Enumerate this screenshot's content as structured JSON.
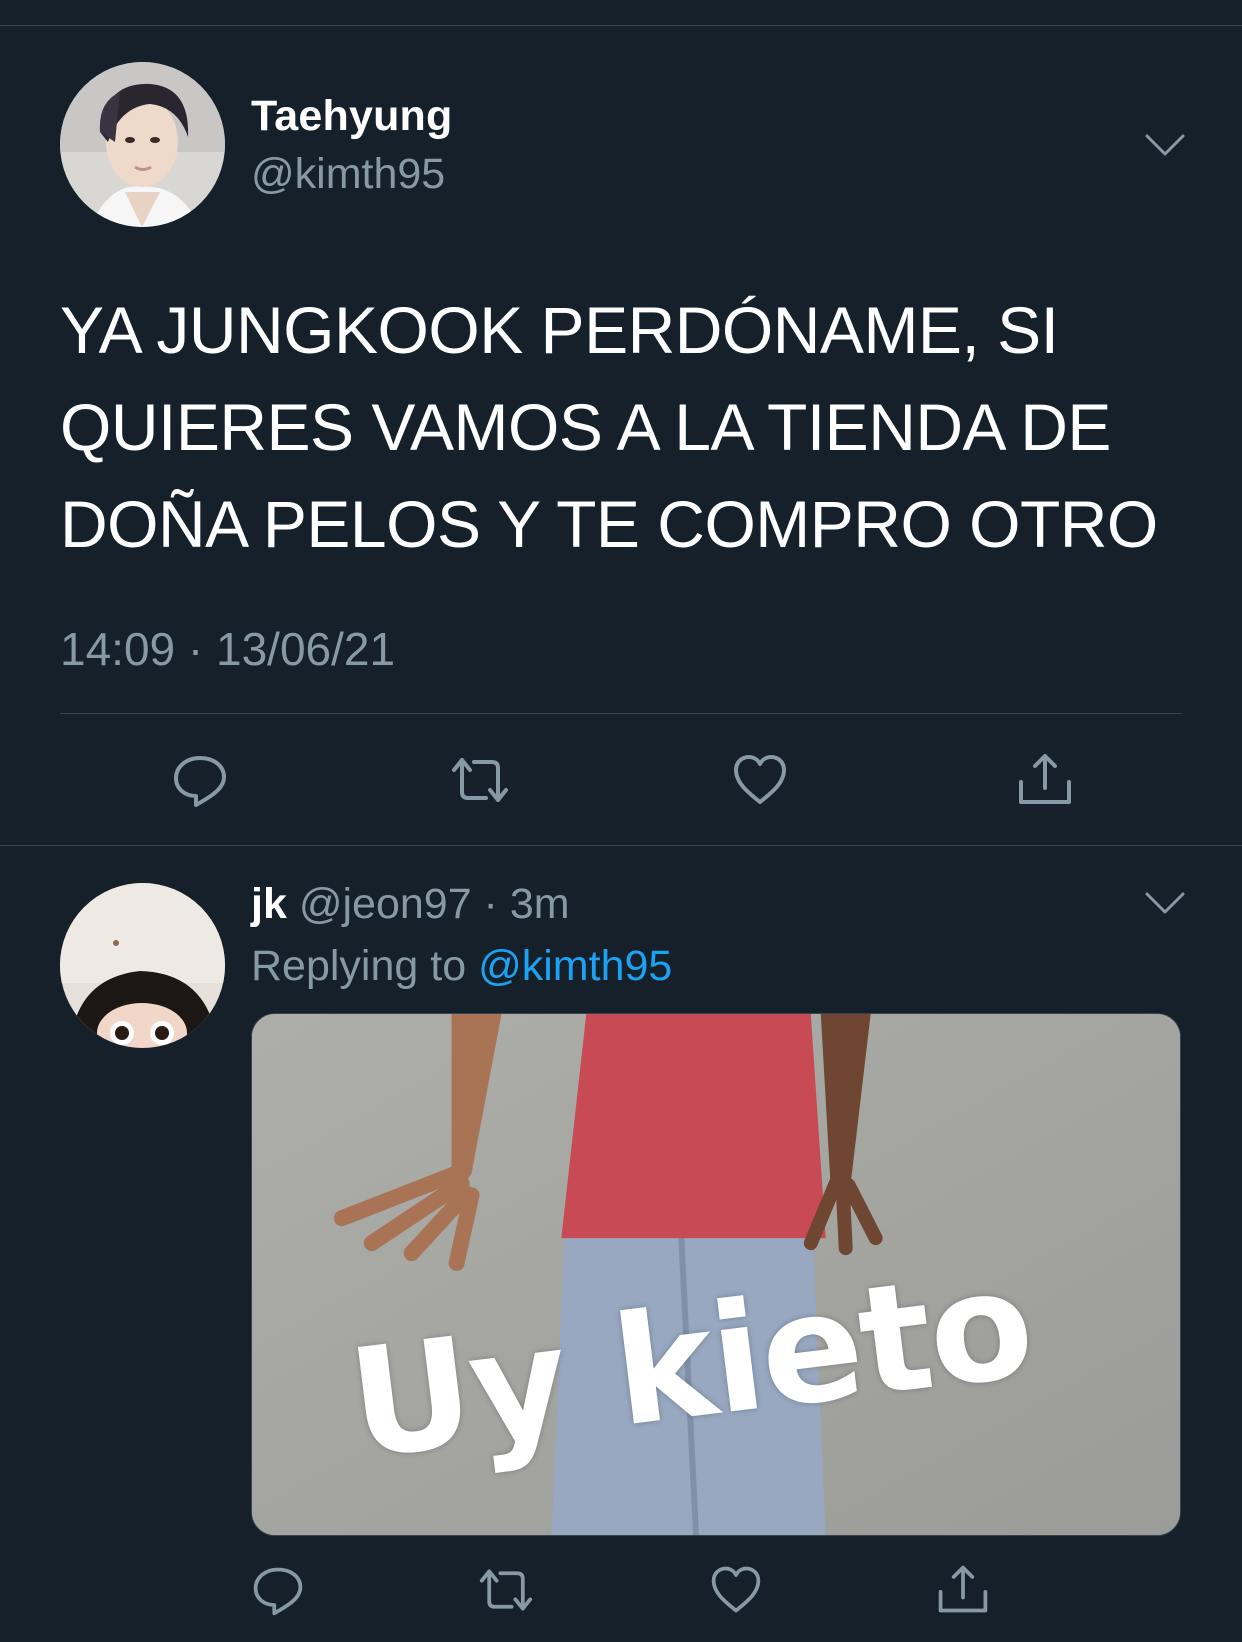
{
  "colors": {
    "background": "#15202b",
    "primary_text": "#ffffff",
    "secondary_text": "#8899a6",
    "link": "#1da1f2",
    "divider": "#38444d"
  },
  "main_tweet": {
    "display_name": "Taehyung",
    "handle": "@kimth95",
    "text": "YA JUNGKOOK PERDÓNAME, SI QUIERES VAMOS A LA TIENDA DE DOÑA PELOS Y TE COMPRO OTRO",
    "timestamp": "14:09 · 13/06/21",
    "avatar_icon": "profile-photo",
    "menu_icon": "chevron-down-icon",
    "actions": [
      "reply-icon",
      "retweet-icon",
      "like-icon",
      "share-icon"
    ]
  },
  "reply_tweet": {
    "display_name": "jk",
    "handle_time": "@jeon97 · 3m",
    "replying_label": "Replying to",
    "replying_handle": "@kimth95",
    "media_caption": "Uy kieto",
    "avatar_icon": "profile-photo",
    "menu_icon": "chevron-down-icon",
    "actions": [
      "reply-icon",
      "retweet-icon",
      "like-icon",
      "share-icon"
    ]
  }
}
